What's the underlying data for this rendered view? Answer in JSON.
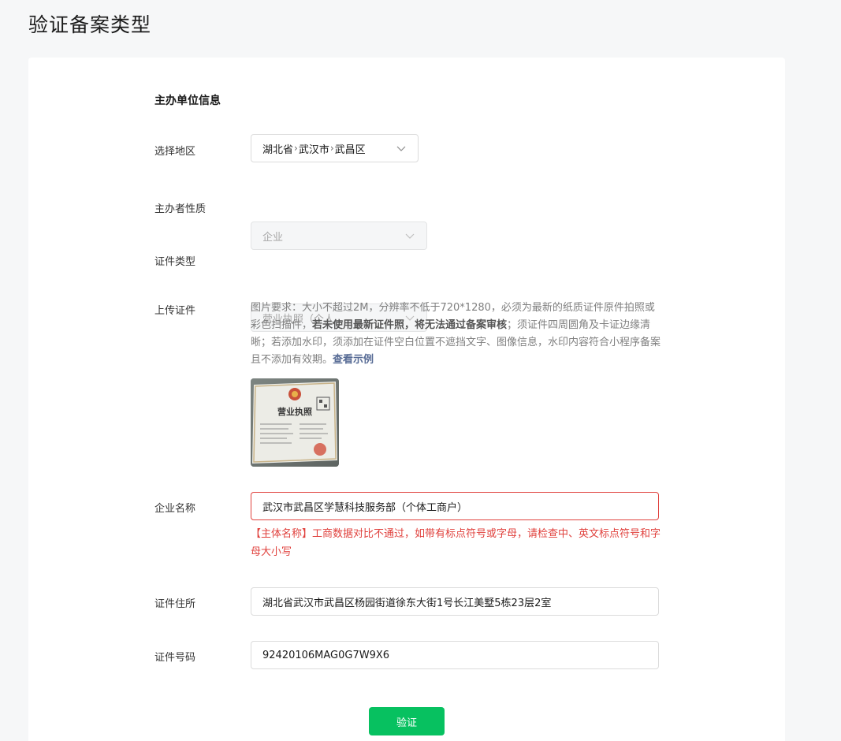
{
  "page": {
    "title": "验证备案类型"
  },
  "form": {
    "section_title": "主办单位信息",
    "region": {
      "label": "选择地区",
      "province": "湖北省",
      "city": "武汉市",
      "district": "武昌区"
    },
    "organizer_nature": {
      "label": "主办者性质",
      "value": "企业"
    },
    "certificate_type": {
      "label": "证件类型",
      "value": "营业执照（个人..."
    },
    "upload": {
      "label": "上传证件",
      "hint_part1": "图片要求：大小不超过2M，分辨率不低于720*1280，必须为最新的纸质证件原件拍照或彩色扫描件，",
      "hint_bold": "若未使用最新证件照，将无法通过备案审核",
      "hint_part2": "；须证件四周圆角及卡证边缘清晰；若添加水印，须添加在证件空白位置不遮挡文字、图像信息，水印内容符合小程序备案且不添加有效期。",
      "example_link": "查看示例",
      "thumb_caption": "营业执照"
    },
    "company_name": {
      "label": "企业名称",
      "value": "武汉市武昌区学慧科技服务部（个体工商户）",
      "error": "【主体名称】工商数据对比不通过，如带有标点符号或字母，请检查中、英文标点符号和字母大小写"
    },
    "address": {
      "label": "证件住所",
      "value": "湖北省武汉市武昌区杨园街道徐东大街1号长江美墅5栋23层2室"
    },
    "certificate_number": {
      "label": "证件号码",
      "value": "92420106MAG0G7W9X6"
    },
    "submit_label": "验证"
  },
  "colors": {
    "primary": "#07c160",
    "error": "#e0403c",
    "link": "#576b95"
  }
}
